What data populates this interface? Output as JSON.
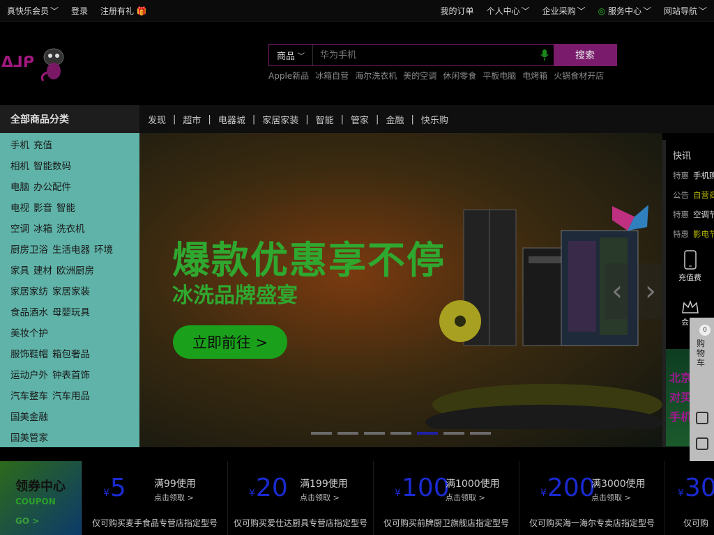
{
  "topbar": {
    "left": [
      "真快乐会员",
      "登录",
      "注册有礼"
    ],
    "right": [
      "我的订单",
      "个人中心",
      "企业采购",
      "服务中心",
      "网站导航"
    ]
  },
  "search": {
    "category": "商品",
    "placeholder": "华为手机",
    "button": "搜索",
    "hotwords": [
      "Apple新品",
      "冰箱自营",
      "海尔洗衣机",
      "美的空调",
      "休闲零食",
      "平板电脑",
      "电烤箱",
      "火锅食材开店"
    ]
  },
  "nav": {
    "all_categories": "全部商品分类",
    "links": [
      "发现",
      "超市",
      "电器城",
      "家居家装",
      "智能",
      "管家",
      "金融",
      "快乐购"
    ]
  },
  "sidebar": {
    "categories": [
      [
        "手机",
        "充值"
      ],
      [
        "相机",
        "智能数码"
      ],
      [
        "电脑",
        "办公配件"
      ],
      [
        "电视",
        "影音",
        "智能"
      ],
      [
        "空调",
        "冰箱",
        "洗衣机"
      ],
      [
        "厨房卫浴",
        "生活电器",
        "环境"
      ],
      [
        "家具",
        "建材",
        "欧洲厨房"
      ],
      [
        "家居家纺",
        "家居家装"
      ],
      [
        "食品酒水",
        "母婴玩具"
      ],
      [
        "美妆个护"
      ],
      [
        "服饰鞋帽",
        "箱包奢品"
      ],
      [
        "运动户外",
        "钟表首饰"
      ],
      [
        "汽车整车",
        "汽车用品"
      ],
      [
        "国美金融"
      ],
      [
        "国美管家"
      ]
    ]
  },
  "banner": {
    "headline": "爆款优惠享不停",
    "subline": "冰洗品牌盛宴",
    "cta": "立即前往 >",
    "slide_count": 7,
    "active_slide": 5
  },
  "news": {
    "title": "快讯",
    "items": [
      {
        "tag": "特惠",
        "text": "手机购"
      },
      {
        "tag": "公告",
        "text": "自营商"
      },
      {
        "tag": "特惠",
        "text": "空调节"
      },
      {
        "tag": "特惠",
        "text": "影电节"
      }
    ],
    "service_recharge": "充值费",
    "service_member": "会",
    "promo_lines": [
      "北京",
      "对买",
      "手机"
    ]
  },
  "float_bar": {
    "badge": "0",
    "cart_label": "购物车"
  },
  "coupons": {
    "head_title": "领券中心",
    "head_sub": "COUPON",
    "head_go": "GO >",
    "items": [
      {
        "amount": "5",
        "condition": "满99使用",
        "claim": "点击领取 >",
        "desc": "仅可购买麦手食品专营店指定型号"
      },
      {
        "amount": "20",
        "condition": "满199使用",
        "claim": "点击领取 >",
        "desc": "仅可购买爱仕达厨具专营店指定型号"
      },
      {
        "amount": "100",
        "condition": "满1000使用",
        "claim": "点击领取 >",
        "desc": "仅可购买前牌厨卫旗舰店指定型号"
      },
      {
        "amount": "200",
        "condition": "满3000使用",
        "claim": "点击领取 >",
        "desc": "仅可购买海一海尔专卖店指定型号"
      },
      {
        "amount": "30",
        "condition": "",
        "claim": "",
        "desc": "仅可购"
      }
    ]
  }
}
